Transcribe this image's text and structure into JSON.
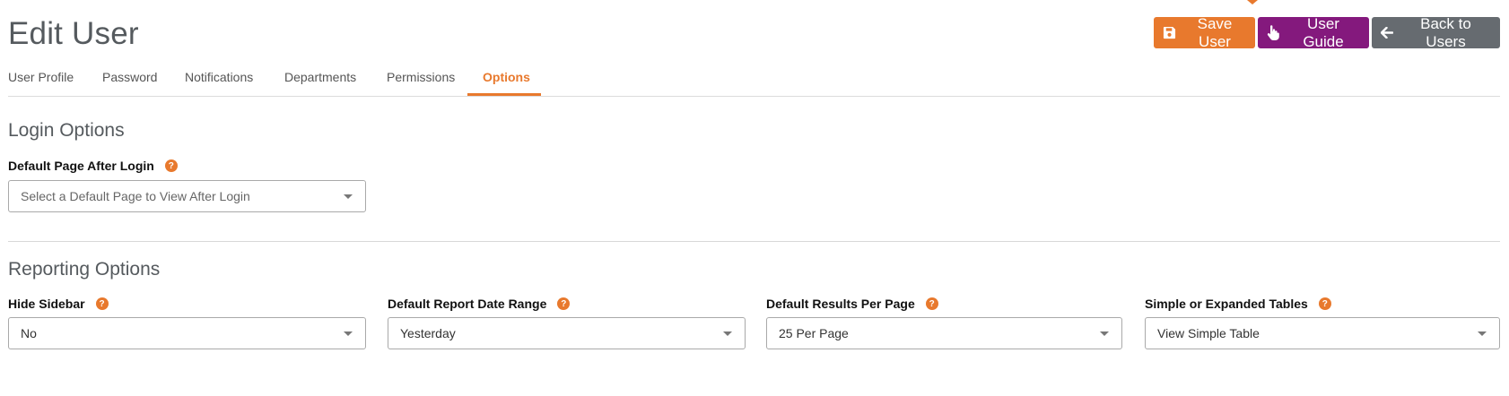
{
  "header": {
    "title": "Edit User",
    "buttons": {
      "save": "Save User",
      "guide": "User Guide",
      "back": "Back to Users"
    }
  },
  "tabs": [
    {
      "label": "User Profile",
      "active": false
    },
    {
      "label": "Password",
      "active": false
    },
    {
      "label": "Notifications",
      "active": false
    },
    {
      "label": "Departments",
      "active": false
    },
    {
      "label": "Permissions",
      "active": false
    },
    {
      "label": "Options",
      "active": true
    }
  ],
  "login_options": {
    "title": "Login Options",
    "default_page": {
      "label": "Default Page After Login",
      "placeholder": "Select a Default Page to View After Login"
    }
  },
  "reporting_options": {
    "title": "Reporting Options",
    "fields": [
      {
        "label": "Hide Sidebar",
        "value": "No"
      },
      {
        "label": "Default Report Date Range",
        "value": "Yesterday"
      },
      {
        "label": "Default Results Per Page",
        "value": "25 Per Page"
      },
      {
        "label": "Simple or Expanded Tables",
        "value": "View Simple Table"
      }
    ]
  },
  "colors": {
    "accent": "#e8792d",
    "guide": "#84197d",
    "back": "#666b70"
  },
  "icons": {
    "save": "save-icon",
    "guide": "pointer-hand-icon",
    "back": "arrow-left-icon",
    "help": "help-icon"
  }
}
